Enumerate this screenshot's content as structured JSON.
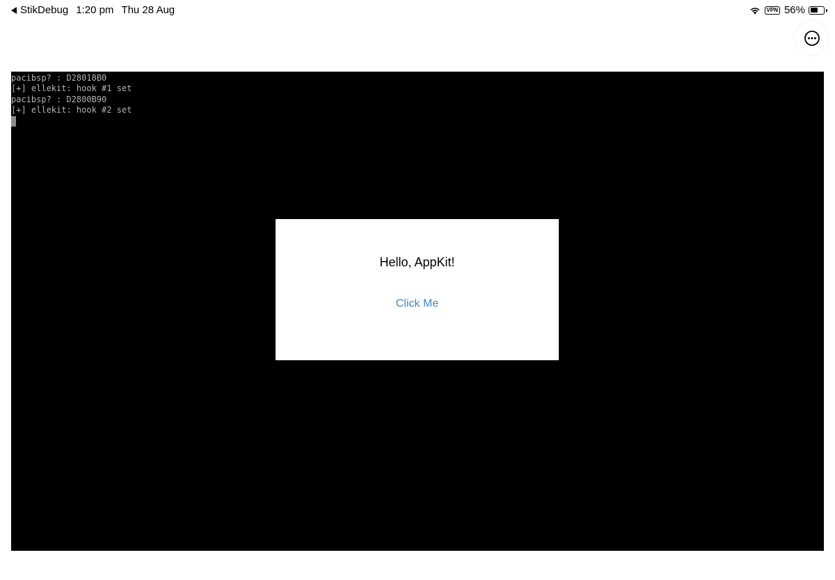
{
  "status_bar": {
    "back_app": "StikDebug",
    "time": "1:20 pm",
    "date": "Thu 28 Aug",
    "vpn_label": "VPN",
    "battery_percent": "56%",
    "battery_level": 0.56,
    "icons": [
      "back-arrow-icon",
      "wifi-icon",
      "vpn-badge",
      "battery-icon"
    ]
  },
  "toolbar": {
    "more_icon": "ellipsis-circle-icon"
  },
  "terminal": {
    "lines": [
      "pacibsp? : D28018B0",
      "[+] ellekit: hook #1 set",
      "pacibsp? : D2800B90",
      "[+] ellekit: hook #2 set"
    ]
  },
  "dialog": {
    "label": "Hello, AppKit!",
    "button_label": "Click Me"
  },
  "colors": {
    "terminal_bg": "#000000",
    "terminal_text": "#b3b3b3",
    "link_blue": "#3a87d4"
  }
}
